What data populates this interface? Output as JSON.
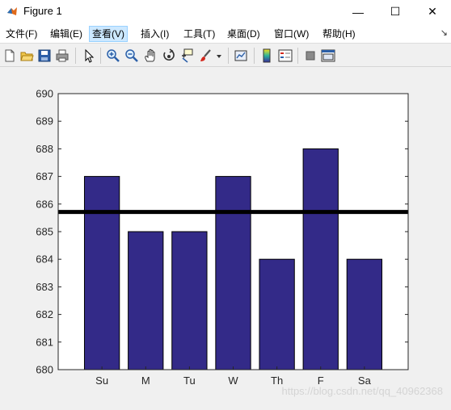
{
  "window": {
    "title": "Figure 1",
    "minimize_glyph": "—",
    "maximize_glyph": "☐",
    "close_glyph": "✕"
  },
  "menu": {
    "items": [
      {
        "label": "文件(F)"
      },
      {
        "label": "编辑(E)"
      },
      {
        "label": "查看(V)"
      },
      {
        "label": "插入(I)"
      },
      {
        "label": "工具(T)"
      },
      {
        "label": "桌面(D)"
      },
      {
        "label": "窗口(W)"
      },
      {
        "label": "帮助(H)"
      }
    ],
    "overflow_glyph": "↘"
  },
  "toolbar_icons": [
    "new-figure-icon",
    "open-file-icon",
    "save-icon",
    "print-icon",
    "select-arrow-icon",
    "zoom-in-icon",
    "zoom-out-icon",
    "pan-hand-icon",
    "rotate-3d-icon",
    "data-cursor-icon",
    "brush-icon",
    "link-plot-icon",
    "insert-colorbar-icon",
    "insert-legend-icon",
    "hide-plot-tools-icon",
    "show-plot-tools-icon"
  ],
  "colors": {
    "bar_fill": "#332a88",
    "bar_edge": "#000000",
    "hline": "#000000",
    "axes_bg": "#ffffff",
    "figure_bg": "#f0f0f0"
  },
  "chart_data": {
    "type": "bar",
    "categories": [
      "Su",
      "M",
      "Tu",
      "W",
      "Th",
      "F",
      "Sa"
    ],
    "values": [
      687,
      685,
      685,
      687,
      684,
      688,
      684
    ],
    "ylim": [
      680,
      690
    ],
    "yticks": [
      680,
      681,
      682,
      683,
      684,
      685,
      686,
      687,
      688,
      689,
      690
    ],
    "hline": 685.7143,
    "title": "",
    "xlabel": "",
    "ylabel": "",
    "grid": false
  },
  "watermark": "https://blog.csdn.net/qq_40962368"
}
